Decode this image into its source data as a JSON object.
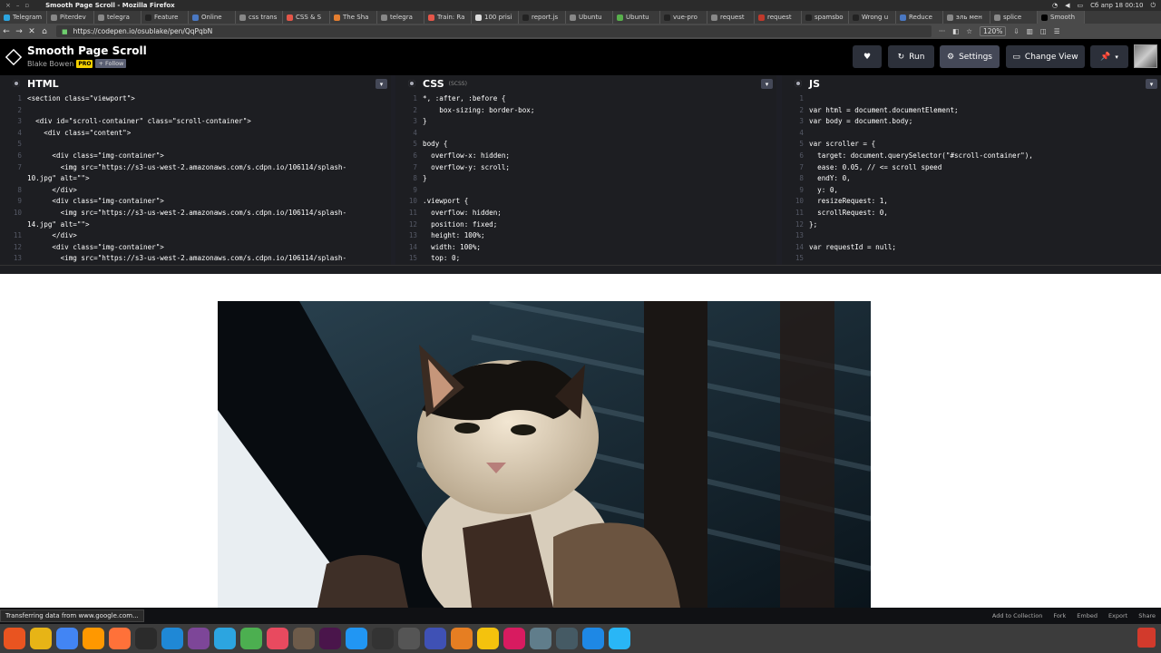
{
  "os": {
    "window_title": "Smooth Page Scroll - Mozilla Firefox",
    "clock": "Сб апр 18   00:10"
  },
  "tabs": [
    {
      "label": "Telegram",
      "color": "#2ca5e0"
    },
    {
      "label": "Piterdev",
      "color": "#888888"
    },
    {
      "label": "telegra",
      "color": "#888888"
    },
    {
      "label": "Feature",
      "color": "#222222"
    },
    {
      "label": "Online",
      "color": "#4a78c2"
    },
    {
      "label": "css trans",
      "color": "#888888"
    },
    {
      "label": "CSS & S",
      "color": "#e45649"
    },
    {
      "label": "The Sha",
      "color": "#e47e30"
    },
    {
      "label": "telegra",
      "color": "#888888"
    },
    {
      "label": "Train: Ra",
      "color": "#e45649"
    },
    {
      "label": "100 prisi",
      "color": "#dddddd"
    },
    {
      "label": "report.js",
      "color": "#222222"
    },
    {
      "label": "Ubuntu",
      "color": "#888888"
    },
    {
      "label": "Ubuntu",
      "color": "#58b04c"
    },
    {
      "label": "vue-pro",
      "color": "#222222"
    },
    {
      "label": "request",
      "color": "#888888"
    },
    {
      "label": "request",
      "color": "#c0392b"
    },
    {
      "label": "spamsbo",
      "color": "#222222"
    },
    {
      "label": "Wrong u",
      "color": "#222222"
    },
    {
      "label": "Reduce",
      "color": "#4a78c2"
    },
    {
      "label": "эль мен",
      "color": "#888888"
    },
    {
      "label": "splice",
      "color": "#888888"
    },
    {
      "label": "Smooth",
      "color": "#000000"
    }
  ],
  "nav": {
    "url": "https://codepen.io/osublake/pen/QqPqbN",
    "zoom": "120%"
  },
  "pen": {
    "title": "Smooth Page Scroll",
    "author": "Blake Bowen",
    "pro": "PRO",
    "follow": "+ Follow"
  },
  "header_buttons": {
    "run": "Run",
    "settings": "Settings",
    "change_view": "Change View"
  },
  "editors": {
    "html": {
      "name": "HTML",
      "lines": [
        {
          "n": "1",
          "t": "<section class=\"viewport\">"
        },
        {
          "n": "2",
          "t": ""
        },
        {
          "n": "3",
          "t": "  <div id=\"scroll-container\" class=\"scroll-container\">"
        },
        {
          "n": "4",
          "t": "    <div class=\"content\">"
        },
        {
          "n": "5",
          "t": ""
        },
        {
          "n": "6",
          "t": "      <div class=\"img-container\">"
        },
        {
          "n": "7",
          "t": "        <img src=\"https://s3-us-west-2.amazonaws.com/s.cdpn.io/106114/splash-"
        },
        {
          "n": "",
          "t": "10.jpg\" alt=\"\">"
        },
        {
          "n": "8",
          "t": "      </div>"
        },
        {
          "n": "9",
          "t": "      <div class=\"img-container\">"
        },
        {
          "n": "10",
          "t": "        <img src=\"https://s3-us-west-2.amazonaws.com/s.cdpn.io/106114/splash-"
        },
        {
          "n": "",
          "t": "14.jpg\" alt=\"\">"
        },
        {
          "n": "11",
          "t": "      </div>"
        },
        {
          "n": "12",
          "t": "      <div class=\"img-container\">"
        },
        {
          "n": "13",
          "t": "        <img src=\"https://s3-us-west-2.amazonaws.com/s.cdpn.io/106114/splash-"
        }
      ]
    },
    "css": {
      "name": "CSS",
      "sub": "(SCSS)",
      "lines": [
        {
          "n": "1",
          "t": "*, :after, :before {"
        },
        {
          "n": "2",
          "t": "    box-sizing: border-box;"
        },
        {
          "n": "3",
          "t": "}"
        },
        {
          "n": "4",
          "t": ""
        },
        {
          "n": "5",
          "t": "body {"
        },
        {
          "n": "6",
          "t": "  overflow-x: hidden;"
        },
        {
          "n": "7",
          "t": "  overflow-y: scroll;"
        },
        {
          "n": "8",
          "t": "}"
        },
        {
          "n": "9",
          "t": ""
        },
        {
          "n": "10",
          "t": ".viewport {"
        },
        {
          "n": "11",
          "t": "  overflow: hidden;"
        },
        {
          "n": "12",
          "t": "  position: fixed;"
        },
        {
          "n": "13",
          "t": "  height: 100%;"
        },
        {
          "n": "14",
          "t": "  width: 100%;"
        },
        {
          "n": "15",
          "t": "  top: 0;"
        }
      ]
    },
    "js": {
      "name": "JS",
      "lines": [
        {
          "n": "1",
          "t": ""
        },
        {
          "n": "2",
          "t": "var html = document.documentElement;"
        },
        {
          "n": "3",
          "t": "var body = document.body;"
        },
        {
          "n": "4",
          "t": ""
        },
        {
          "n": "5",
          "t": "var scroller = {"
        },
        {
          "n": "6",
          "t": "  target: document.querySelector(\"#scroll-container\"),"
        },
        {
          "n": "7",
          "t": "  ease: 0.05, // <= scroll speed"
        },
        {
          "n": "8",
          "t": "  endY: 0,"
        },
        {
          "n": "9",
          "t": "  y: 0,"
        },
        {
          "n": "10",
          "t": "  resizeRequest: 1,"
        },
        {
          "n": "11",
          "t": "  scrollRequest: 0,"
        },
        {
          "n": "12",
          "t": "};"
        },
        {
          "n": "13",
          "t": ""
        },
        {
          "n": "14",
          "t": "var requestId = null;"
        },
        {
          "n": "15",
          "t": ""
        }
      ]
    }
  },
  "status": "Transferring data from www.google.com...",
  "footer_links": [
    "Add to Collection",
    "Fork",
    "Embed",
    "Export",
    "Share"
  ],
  "dock": [
    {
      "icon": "ubuntu-icon",
      "color": "#e95420"
    },
    {
      "icon": "files-icon",
      "color": "#e7b416"
    },
    {
      "icon": "chrome-icon",
      "color": "#4285f4"
    },
    {
      "icon": "sublime-icon",
      "color": "#ff9800"
    },
    {
      "icon": "firefox-icon",
      "color": "#ff7139"
    },
    {
      "icon": "terminal-icon",
      "color": "#2b2b2b"
    },
    {
      "icon": "vscode-icon",
      "color": "#1f88d6"
    },
    {
      "icon": "tor-icon",
      "color": "#7d4698"
    },
    {
      "icon": "telegram-icon",
      "color": "#2ca5e0"
    },
    {
      "icon": "app-icon",
      "color": "#4caf50"
    },
    {
      "icon": "app-icon",
      "color": "#e84a5f"
    },
    {
      "icon": "gimp-icon",
      "color": "#6d5b4a"
    },
    {
      "icon": "slack-icon",
      "color": "#4a154b"
    },
    {
      "icon": "app-icon",
      "color": "#2196f3"
    },
    {
      "icon": "inkscape-icon",
      "color": "#333333"
    },
    {
      "icon": "calculator-icon",
      "color": "#555555"
    },
    {
      "icon": "app-icon",
      "color": "#3f51b5"
    },
    {
      "icon": "app-icon",
      "color": "#e67e22"
    },
    {
      "icon": "app-icon",
      "color": "#f4c20d"
    },
    {
      "icon": "app-icon",
      "color": "#d81b60"
    },
    {
      "icon": "app-icon",
      "color": "#607d8b"
    },
    {
      "icon": "app-icon",
      "color": "#455a64"
    },
    {
      "icon": "app-icon",
      "color": "#1e88e5"
    },
    {
      "icon": "app-icon",
      "color": "#29b6f6"
    }
  ]
}
